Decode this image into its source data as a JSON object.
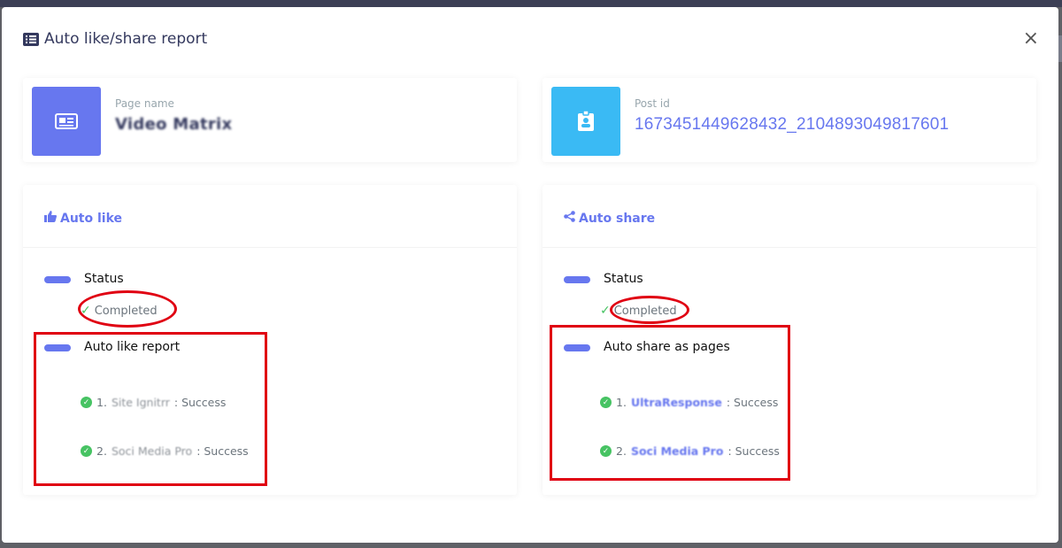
{
  "modal": {
    "title": "Auto like/share report",
    "close_label": "×"
  },
  "page_card": {
    "label": "Page name",
    "value": "Video Matrix",
    "icon": "newspaper-icon",
    "color": "#6777ef"
  },
  "post_card": {
    "label": "Post id",
    "value": "1673451449628432_2104893049817601",
    "icon": "id-badge-icon",
    "color": "#3abaf4"
  },
  "auto_like": {
    "title": "Auto like",
    "status_label": "Status",
    "status_value": "Completed",
    "report_label": "Auto like report",
    "items": [
      {
        "index": "1.",
        "name": "Site Ignitrr",
        "result": " : Success"
      },
      {
        "index": "2.",
        "name": "Soci Media Pro",
        "result": " : Success"
      }
    ]
  },
  "auto_share": {
    "title": "Auto share",
    "status_label": "Status",
    "status_value": "Completed",
    "report_label": "Auto share as pages",
    "items": [
      {
        "index": "1.",
        "name": "UltraResponse",
        "result": " : Success"
      },
      {
        "index": "2.",
        "name": "Soci Media Pro",
        "result": " : Success"
      }
    ]
  },
  "colors": {
    "accent": "#6777ef",
    "success": "#47c363",
    "highlight": "#e00012"
  }
}
